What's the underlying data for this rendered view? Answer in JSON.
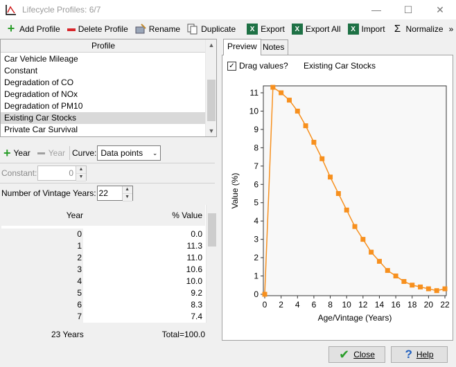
{
  "window": {
    "title": "Lifecycle Profiles: 6/7"
  },
  "toolbar": {
    "add_profile": "Add Profile",
    "delete_profile": "Delete Profile",
    "rename": "Rename",
    "duplicate": "Duplicate",
    "export": "Export",
    "export_all": "Export All",
    "import": "Import",
    "normalize": "Normalize",
    "overflow": "»"
  },
  "profiles": {
    "header": "Profile",
    "items": [
      "Car Vehicle Mileage",
      "Constant",
      "Degradation of CO",
      "Degradation of NOx",
      "Degradation of PM10",
      "Existing Car Stocks",
      "Private Car Survival"
    ],
    "selected": "Existing Car Stocks"
  },
  "controls": {
    "add_year": "Year",
    "remove_year": "Year",
    "curve_label": "Curve:",
    "curve_value": "Data points",
    "constant_label": "Constant:",
    "constant_value": "0",
    "vintage_label": "Number of Vintage Years:",
    "vintage_value": "22"
  },
  "table": {
    "col_year": "Year",
    "col_value": "% Value",
    "rows": [
      {
        "year": "0",
        "value": "0.0"
      },
      {
        "year": "1",
        "value": "11.3"
      },
      {
        "year": "2",
        "value": "11.0"
      },
      {
        "year": "3",
        "value": "10.6"
      },
      {
        "year": "4",
        "value": "10.0"
      },
      {
        "year": "5",
        "value": "9.2"
      },
      {
        "year": "6",
        "value": "8.3"
      },
      {
        "year": "7",
        "value": "7.4"
      }
    ],
    "footer_years": "23 Years",
    "footer_total": "Total=100.0"
  },
  "preview": {
    "tab_preview": "Preview",
    "tab_notes": "Notes",
    "drag_label": "Drag values?",
    "profile_name": "Existing Car Stocks"
  },
  "chart_data": {
    "type": "line",
    "title": "",
    "xlabel": "Age/Vintage (Years)",
    "ylabel": "Value (%)",
    "xlim": [
      0,
      22
    ],
    "ylim": [
      0,
      11
    ],
    "xticks": [
      0,
      2,
      4,
      6,
      8,
      10,
      12,
      14,
      16,
      18,
      20,
      22
    ],
    "yticks": [
      0,
      1,
      2,
      3,
      4,
      5,
      6,
      7,
      8,
      9,
      10,
      11
    ],
    "x": [
      0,
      1,
      2,
      3,
      4,
      5,
      6,
      7,
      8,
      9,
      10,
      11,
      12,
      13,
      14,
      15,
      16,
      17,
      18,
      19,
      20,
      21,
      22
    ],
    "y": [
      0.0,
      11.3,
      11.0,
      10.6,
      10.0,
      9.2,
      8.3,
      7.4,
      6.4,
      5.5,
      4.6,
      3.7,
      3.0,
      2.3,
      1.8,
      1.3,
      1.0,
      0.7,
      0.5,
      0.4,
      0.3,
      0.2,
      0.3
    ],
    "color": "#f7901e"
  },
  "buttons": {
    "close": "Close",
    "help": "Help"
  }
}
